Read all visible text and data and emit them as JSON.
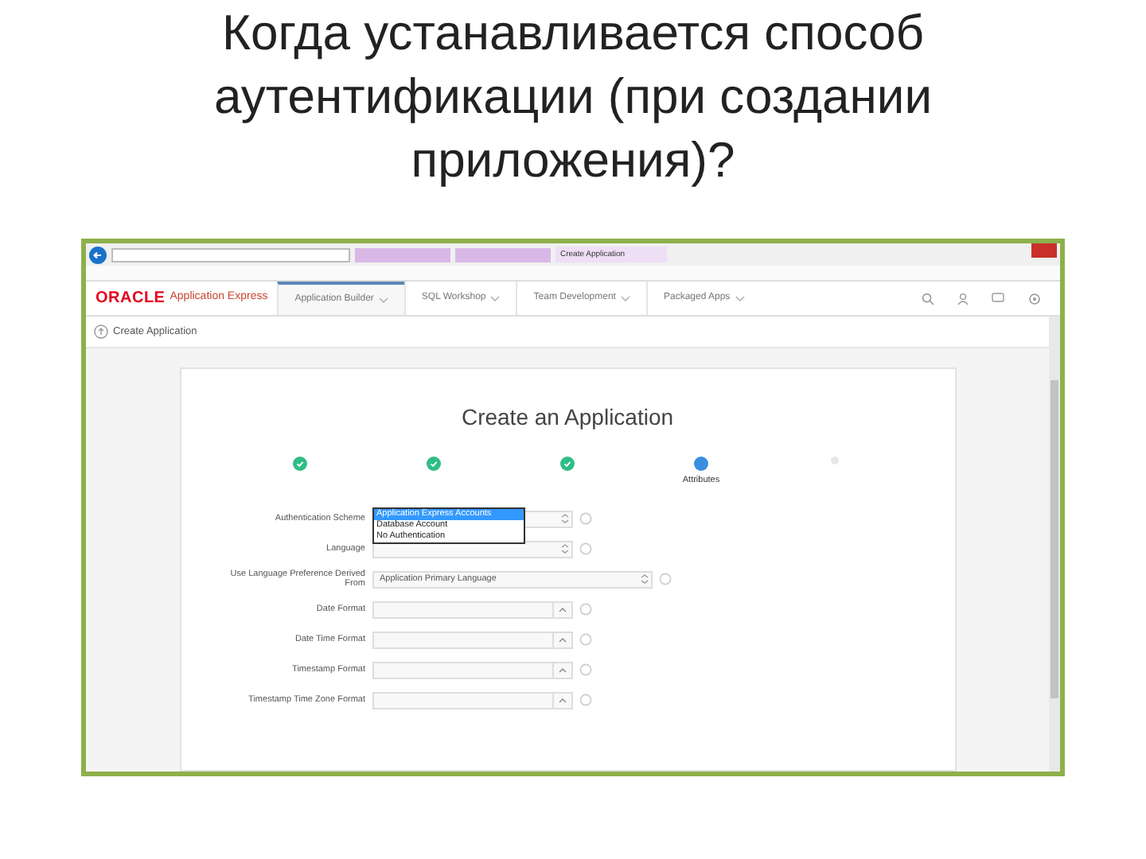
{
  "slide_title": "Когда устанавливается способ аутентификации (при создании приложения)?",
  "browser": {
    "tabs": [
      {
        "label": "Create Application",
        "selected": true
      }
    ]
  },
  "app_header": {
    "logo": "ORACLE",
    "product": "Application Express",
    "nav": [
      {
        "label": "Application Builder",
        "selected": true
      },
      {
        "label": "SQL Workshop",
        "selected": false
      },
      {
        "label": "Team Development",
        "selected": false
      },
      {
        "label": "Packaged Apps",
        "selected": false
      }
    ]
  },
  "breadcrumb": "Create Application",
  "card": {
    "title": "Create an Application",
    "steps": [
      {
        "kind": "done"
      },
      {
        "kind": "done"
      },
      {
        "kind": "done"
      },
      {
        "kind": "current",
        "label": "Attributes"
      },
      {
        "kind": "pending"
      }
    ],
    "fields": [
      {
        "label": "Authentication Scheme",
        "kind": "dropdown",
        "options": [
          {
            "label": "Application Express Accounts",
            "selected": true
          },
          {
            "label": "Database Account",
            "selected": false
          },
          {
            "label": "No Authentication",
            "selected": false
          }
        ]
      },
      {
        "label": "Language",
        "kind": "select"
      },
      {
        "label": "Use Language Preference Derived From",
        "kind": "select",
        "value": "Application Primary Language"
      },
      {
        "label": "Date Format",
        "kind": "combo"
      },
      {
        "label": "Date Time Format",
        "kind": "combo"
      },
      {
        "label": "Timestamp Format",
        "kind": "combo"
      },
      {
        "label": "Timestamp Time Zone Format",
        "kind": "combo"
      }
    ]
  }
}
